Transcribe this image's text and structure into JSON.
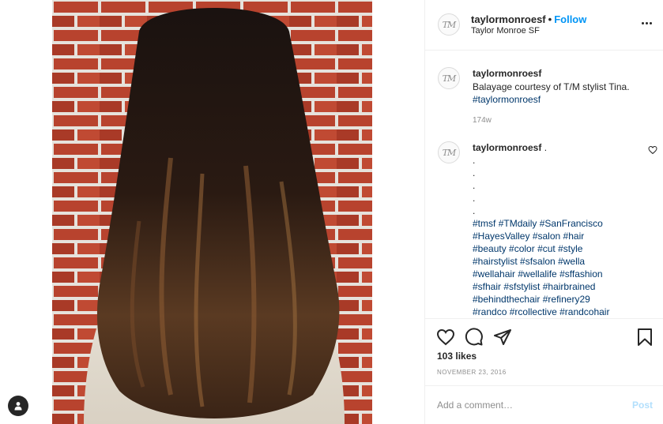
{
  "post": {
    "username": "taylormonroesf",
    "dot": "•",
    "follow_label": "Follow",
    "location": "Taylor Monroe SF",
    "avatar_initials": "TM",
    "more_icon": "more-horizontal-icon"
  },
  "caption": {
    "username": "taylormonroesf",
    "text": "Balayage courtesy of T/M stylist Tina.",
    "hashtag": "#taylormonroesf",
    "time": "174w"
  },
  "comment": {
    "username": "taylormonroesf",
    "first_text": ".",
    "dots": [
      ".",
      ".",
      ".",
      ".",
      "."
    ],
    "tag_lines": [
      [
        "#tmsf",
        "#TMdaily",
        "#SanFrancisco"
      ],
      [
        "#HayesValley",
        "#salon",
        "#hair"
      ],
      [
        "#beauty",
        "#color",
        "#cut",
        "#style"
      ],
      [
        "#hairstylist",
        "#sfsalon",
        "#wella"
      ],
      [
        "#wellahair",
        "#wellalife",
        "#sffashion"
      ],
      [
        "#sfhair",
        "#sfstylist",
        "#hairbrained"
      ],
      [
        "#behindthechair",
        "#refinery29"
      ],
      [
        "#randco",
        "#rcollective",
        "#randcohair"
      ]
    ]
  },
  "actions": {
    "likes": "103 likes",
    "date": "NOVEMBER 23, 2016",
    "icons": [
      "heart-icon",
      "comment-icon",
      "share-icon",
      "bookmark-icon"
    ]
  },
  "add_comment": {
    "placeholder": "Add a comment…",
    "post_label": "Post"
  },
  "media": {
    "user_tag_icon": "user-tag-icon"
  },
  "colors": {
    "link": "#0095f6",
    "hashtag": "#00376b",
    "muted": "#8e8e8e",
    "brick": "#b8432e",
    "hair": "#2a1a12",
    "sweater": "#e8e2d6"
  }
}
